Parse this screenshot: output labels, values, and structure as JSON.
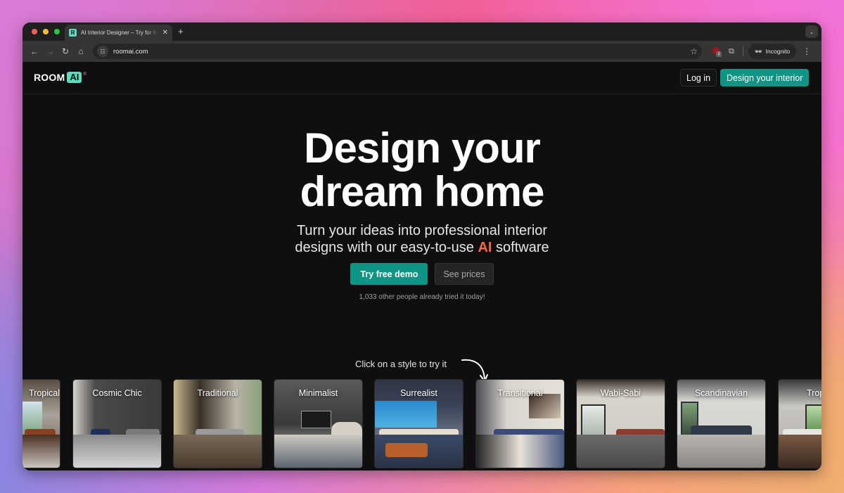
{
  "browser": {
    "tab_title": "AI Interior Designer – Try for free",
    "favicon_letter": "R",
    "url": "roomai.com",
    "incognito_label": "Incognito",
    "extension_badge": "1",
    "traffic_lights": [
      "#fe5f57",
      "#febc2e",
      "#28c840"
    ]
  },
  "site": {
    "logo_room": "ROOM",
    "logo_ai": "AI",
    "logo_reg": "®",
    "login_label": "Log in",
    "design_label": "Design your interior",
    "brand_color": "#0f9485",
    "logo_accent": "#5fd9bf"
  },
  "hero": {
    "title_line1": "Design your",
    "title_line2": "dream home",
    "subtitle_line1": "Turn your ideas into professional interior",
    "subtitle_pre": "designs with our easy-to-use ",
    "subtitle_ai": "AI",
    "subtitle_post": " software",
    "ai_color": "#f26b4a",
    "try_demo_label": "Try free demo",
    "see_prices_label": "See prices",
    "social_proof": "1,033 other people already tried it today!"
  },
  "styles": {
    "hint": "Click on a style to try it",
    "items": [
      {
        "label": "Tropical",
        "visible_label": "cal"
      },
      {
        "label": "Cosmic Chic"
      },
      {
        "label": "Traditional"
      },
      {
        "label": "Minimalist"
      },
      {
        "label": "Surrealist"
      },
      {
        "label": "Transitional"
      },
      {
        "label": "Wabi-Sabi"
      },
      {
        "label": "Scandinavian"
      },
      {
        "label": "Tropical",
        "visible_label": "Trop"
      }
    ]
  }
}
